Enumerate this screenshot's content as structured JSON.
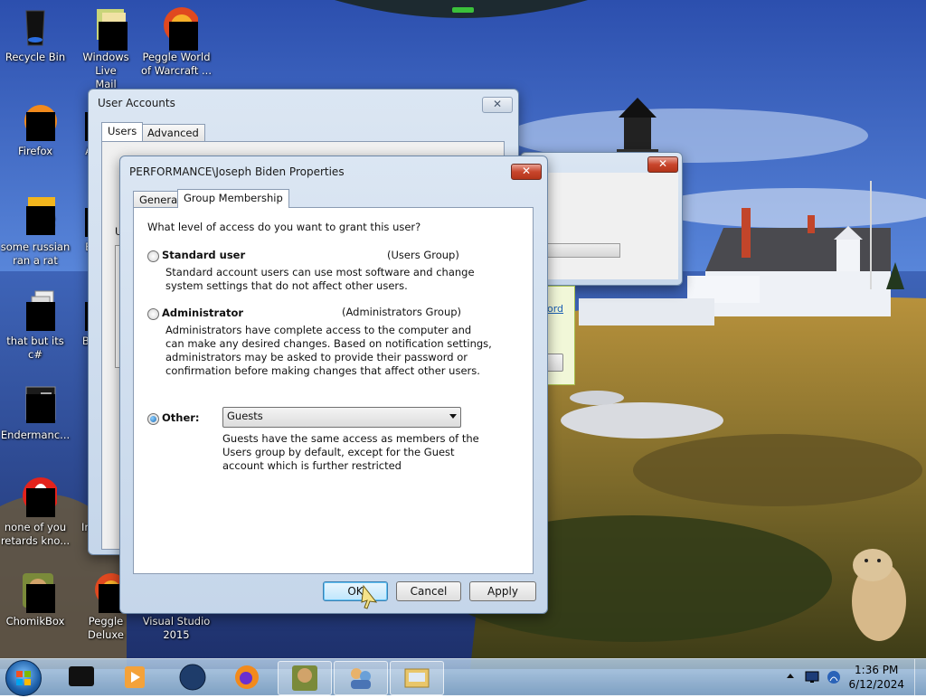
{
  "desktop": {
    "icons": [
      {
        "label": "Recycle Bin"
      },
      {
        "label": "Windows Live\nMail"
      },
      {
        "label": "Peggle World\nof Warcraft ..."
      },
      {
        "label": "Firefox"
      },
      {
        "label": "some russian\nran a rat"
      },
      {
        "label": "that but its c#"
      },
      {
        "label": "Endermanc..."
      },
      {
        "label": "none of you\nretards kno..."
      },
      {
        "label": "ChomikBox"
      },
      {
        "label": "Peggle Deluxe"
      },
      {
        "label": "Visual Studio\n2015"
      },
      {
        "label": "A"
      },
      {
        "label": "B"
      },
      {
        "label": "Bi"
      },
      {
        "label": "Ins"
      }
    ]
  },
  "user_accounts": {
    "title": "User Accounts",
    "tabs": [
      "Users",
      "Advanced"
    ],
    "close_glyph": "✕",
    "fragment_u": "U"
  },
  "bg_window": {
    "close_glyph": "✕",
    "link_fragment": "ord"
  },
  "props": {
    "title": "PERFORMANCE\\Joseph Biden Properties",
    "close_glyph": "✕",
    "tabs": [
      "General",
      "Group Membership"
    ],
    "question": "What level of access do you want to grant this user?",
    "standard": {
      "label": "Standard user",
      "group": "(Users Group)",
      "desc1": "Standard account users can use most software and change",
      "desc2": "system settings that do not affect other users."
    },
    "admin": {
      "label": "Administrator",
      "group": "(Administrators Group)",
      "desc1": "Administrators have complete access to the computer and",
      "desc2": "can make any desired changes. Based on notification settings,",
      "desc3": "administrators may be asked to provide their password or",
      "desc4": "confirmation before making changes that affect other users."
    },
    "other": {
      "label": "Other:",
      "selected": "Guests",
      "desc1": "Guests have the same access as members of the",
      "desc2": "Users group by default, except for the Guest",
      "desc3": "account which is further restricted"
    },
    "buttons": {
      "ok": "OK",
      "cancel": "Cancel",
      "apply": "Apply"
    }
  },
  "taskbar": {
    "time": "1:36 PM",
    "date": "6/12/2024"
  }
}
